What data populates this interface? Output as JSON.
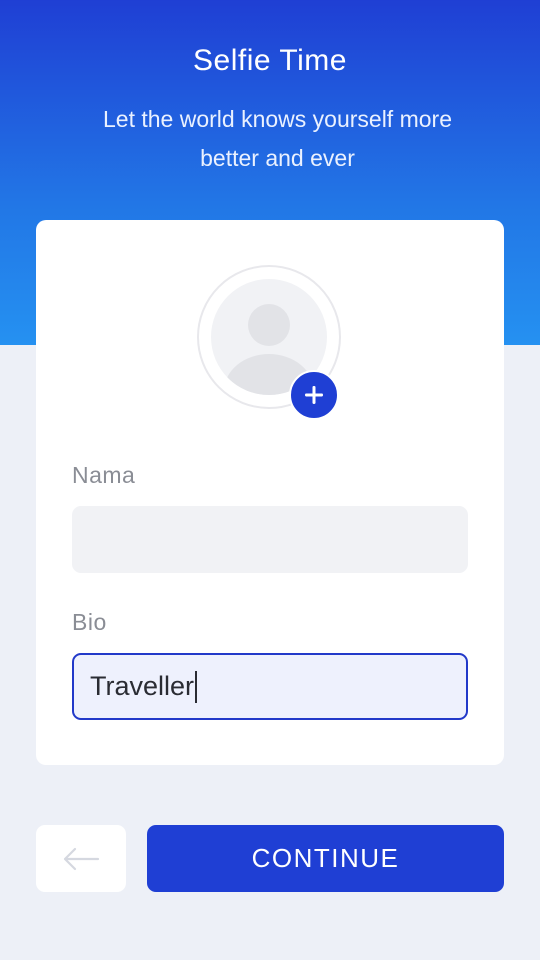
{
  "header": {
    "title": "Selfie Time",
    "subtitle": "Let the world knows yourself more better and ever"
  },
  "profile": {
    "avatar_icon": "user-placeholder-icon",
    "add_photo_icon": "plus-icon"
  },
  "form": {
    "nama": {
      "label": "Nama",
      "value": ""
    },
    "bio": {
      "label": "Bio",
      "value": "Traveller"
    }
  },
  "actions": {
    "back_icon": "arrow-left-icon",
    "continue_label": "CONTINUE"
  },
  "colors": {
    "primary": "#1f3fd4",
    "gradient_end": "#2591f1",
    "background": "#edf0f7",
    "input_bg": "#f1f2f5",
    "input_focus_bg": "#eef1fd",
    "label": "#8a8d95"
  }
}
